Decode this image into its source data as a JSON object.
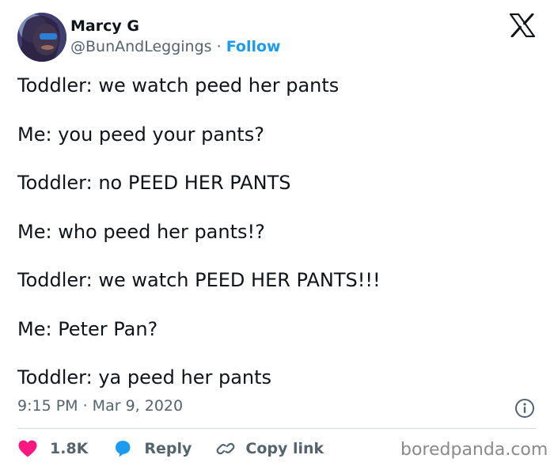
{
  "author": {
    "name": "Marcy G",
    "handle": "@BunAndLeggings",
    "separator": " · ",
    "follow_label": "Follow"
  },
  "platform_icon": "x-logo-icon",
  "tweet": {
    "lines": [
      "Toddler: we watch peed her pants",
      "Me: you peed your pants?",
      "Toddler: no PEED HER PANTS",
      "Me: who peed her pants!?",
      "Toddler: we watch PEED HER PANTS!!!",
      "Me: Peter Pan?",
      "Toddler: ya peed her pants"
    ],
    "timestamp": "9:15 PM · Mar 9, 2020"
  },
  "actions": {
    "likes": "1.8K",
    "reply_label": "Reply",
    "copy_link_label": "Copy link"
  },
  "watermark": "boredpanda.com",
  "colors": {
    "accent": "#1d9bf0",
    "like": "#f91880",
    "text": "#0f1419",
    "secondary": "#536471"
  }
}
